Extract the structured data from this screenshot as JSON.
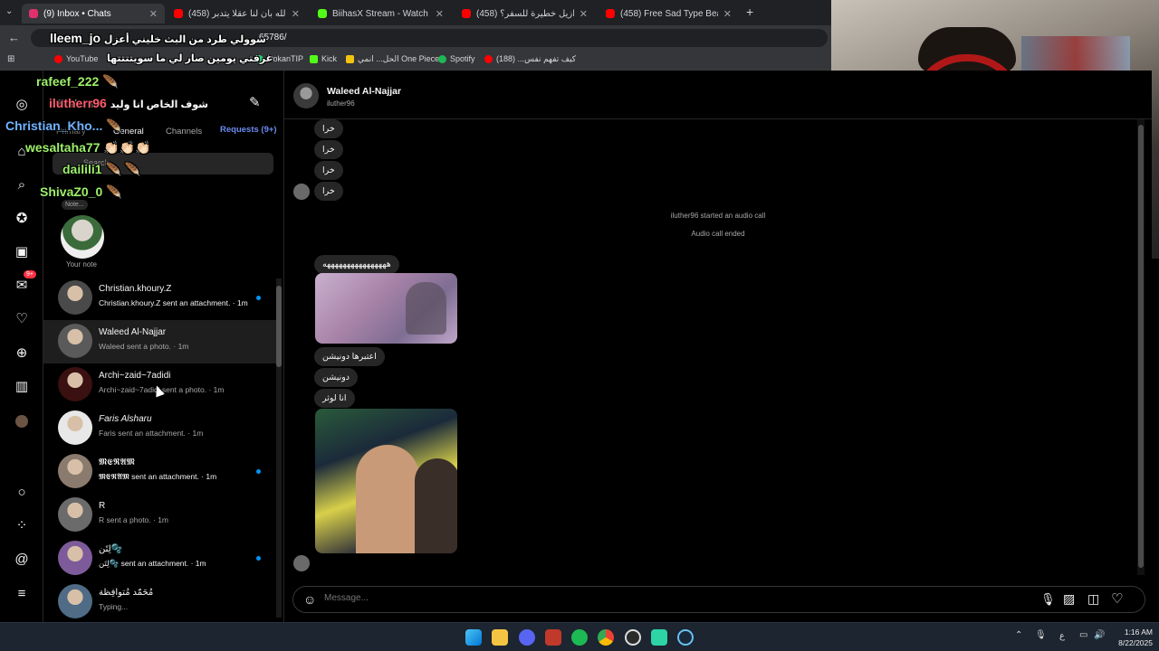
{
  "browser": {
    "tabs": [
      {
        "title": "(9) Inbox • Chats",
        "fav_color": "#e1306c"
      },
      {
        "title": "(458) ميرنا الله بأن لنا عقلا يتدبر ...",
        "fav_color": "#ff0000"
      },
      {
        "title": "BiihasX Stream - Watch Live on ...",
        "fav_color": "#53fc18"
      },
      {
        "title": "(458) هل البرازيل خطيرة للسفر؟",
        "fav_color": "#ff0000"
      },
      {
        "title": "(458) Free Sad Type Beat - \"My ...",
        "fav_color": "#ff0000"
      }
    ],
    "new_tab": "+",
    "url": "65786/",
    "bookmarks": [
      {
        "label": "YouTube",
        "color": "#ff0000"
      },
      {
        "label": "DokanTIP",
        "color": "#2ecc71"
      },
      {
        "label": "Kick",
        "color": "#53fc18"
      },
      {
        "label": "الحل... انمي One Piece",
        "color": "#f1c40f"
      },
      {
        "label": "Spotify",
        "color": "#1db954"
      },
      {
        "label": "كيف تفهم نفس... (188)",
        "color": "#ff0000"
      }
    ]
  },
  "stream_overlay": {
    "lines": [
      {
        "user": "lleem_jo",
        "text": "سوولي طرد من البث خليني أعزل"
      },
      {
        "user": "",
        "text": "غرفتي يومين صار لي ما سويتتتتها"
      },
      {
        "user": "rafeef_222",
        "text": "🪶"
      },
      {
        "user": "ilutherr96",
        "text": "شوف الخاص انا وليد"
      },
      {
        "user": "Christian_Kho...",
        "text": "🪶"
      },
      {
        "user": "wesaltaha77",
        "text": "👏🏻👏🏻👏🏻"
      },
      {
        "user": "dailili1",
        "text": "🪶 🪶"
      },
      {
        "user": "ShivaZ0_0",
        "text": "🪶"
      }
    ]
  },
  "inbox": {
    "username": "ilutherr",
    "compose_icon": "edit-icon",
    "tabs": [
      "Primary",
      "General",
      "Channels",
      "Requests (9+)"
    ],
    "search_placeholder": "Search",
    "note_bubble": "Note...",
    "your_note": "Your note",
    "chats": [
      {
        "name": "Christian.khoury.Z",
        "preview": "Christian.khoury.Z sent an attachment. · 1m",
        "unread": true,
        "avatar_color": "#4a4a4a"
      },
      {
        "name": "Waleed Al-Najjar",
        "preview": "Waleed sent a photo. · 1m",
        "unread": false,
        "avatar_color": "#5a5a5a"
      },
      {
        "name": "Archi~zaid~7adidi",
        "preview": "Archi~zaid~7adidi sent a photo. · 1m",
        "unread": false,
        "avatar_color": "#3a1010"
      },
      {
        "name": "Faris Alsharu",
        "preview": "Faris sent an attachment. · 1m",
        "unread": false,
        "avatar_color": "#e8e8e8"
      },
      {
        "name": "𝕸𝕰𝕽𝕬𝕸",
        "preview": "𝕸𝕰𝕽𝕬𝕸 sent an attachment. · 1m",
        "unread": true,
        "avatar_color": "#8a7b6e"
      },
      {
        "name": "R",
        "preview": "R sent a photo. · 1m",
        "unread": false,
        "avatar_color": "#6b6b6b"
      },
      {
        "name": "لِتَن🫧",
        "preview": "لِتَن🫧 sent an attachment. · 1m",
        "unread": true,
        "avatar_color": "#7d5b9a"
      },
      {
        "name": "مُحَمّد مُتوافِظة",
        "preview": "Typing...",
        "unread": false,
        "avatar_color": "#4f6b86"
      }
    ]
  },
  "rail": {
    "items": [
      "instagram-logo-icon",
      "home-icon",
      "search-icon",
      "explore-icon",
      "reels-icon",
      "messages-icon",
      "notifications-icon",
      "create-icon",
      "dashboard-icon",
      "profile-icon",
      "threads-icon",
      "more-icon",
      "menu-icon"
    ],
    "badge": "9+"
  },
  "conversation": {
    "name": "Waleed Al-Najjar",
    "handle": "iluther96",
    "messages": [
      "خرا",
      "خرا",
      "خرا",
      "خرا"
    ],
    "system_call_started": "iluther96 started an audio call",
    "system_call_ended": "Audio call ended",
    "laugh_message": "ههههههههههههههههه",
    "messages_after_photo": [
      "اعتبرها دونيشن",
      "دونيشن",
      "انا لوثر"
    ],
    "composer_placeholder": "Message...",
    "composer_icons": [
      "microphone-icon",
      "image-icon",
      "sticker-icon",
      "heart-icon"
    ]
  },
  "taskbar": {
    "time": "1:16 AM",
    "date": "8/22/2025",
    "lang": "ع"
  }
}
